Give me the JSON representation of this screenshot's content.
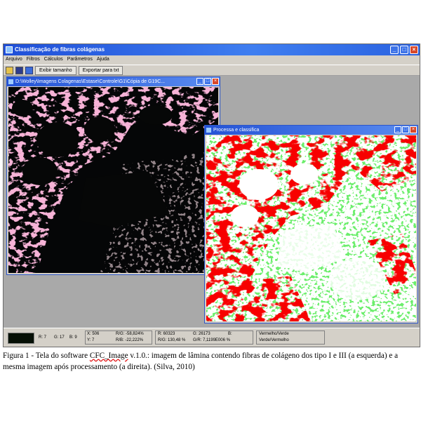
{
  "window": {
    "title": "Classificação de fibras colágenas",
    "menu": [
      "Arquivo",
      "Filtros",
      "Cálculos",
      "Parâmetros",
      "Ajuda"
    ],
    "toolbar": {
      "exibir_label": "Exibir tamanho",
      "exportar_label": "Exportar para txt"
    }
  },
  "child_original": {
    "title": "D:\\Wolley\\Imagens Colagenas\\Estase\\Controle\\G1\\Cópia de G19C..."
  },
  "child_processed": {
    "title": "Processa e classifica"
  },
  "status": {
    "swatch_color": "#061006",
    "r": "R: 7",
    "g": "G: 17",
    "b": "B: 9",
    "x": "X: 506",
    "y": "Y: 7",
    "rg": "R/G: -58,824%",
    "rb": "R/B: -22,222%",
    "r_total": "R: 60323",
    "g_total": "G: 26173",
    "b_total": "B:",
    "rg_total": "R/G: 130,48 %",
    "gr_total": "G/R: 7,1199E006 %",
    "class1": "Vermelho/Verde",
    "class2": "Verde/Vermelho"
  },
  "caption": {
    "part1": "Figura 1 - Tela do software ",
    "software": "CFC_Image",
    "part2": " v.1.0.: imagem de lâmina contendo fibras de colágeno dos tipo I e III (a esquerda) e a mesma imagem após processamento (a direita). (Silva, 2010)"
  }
}
